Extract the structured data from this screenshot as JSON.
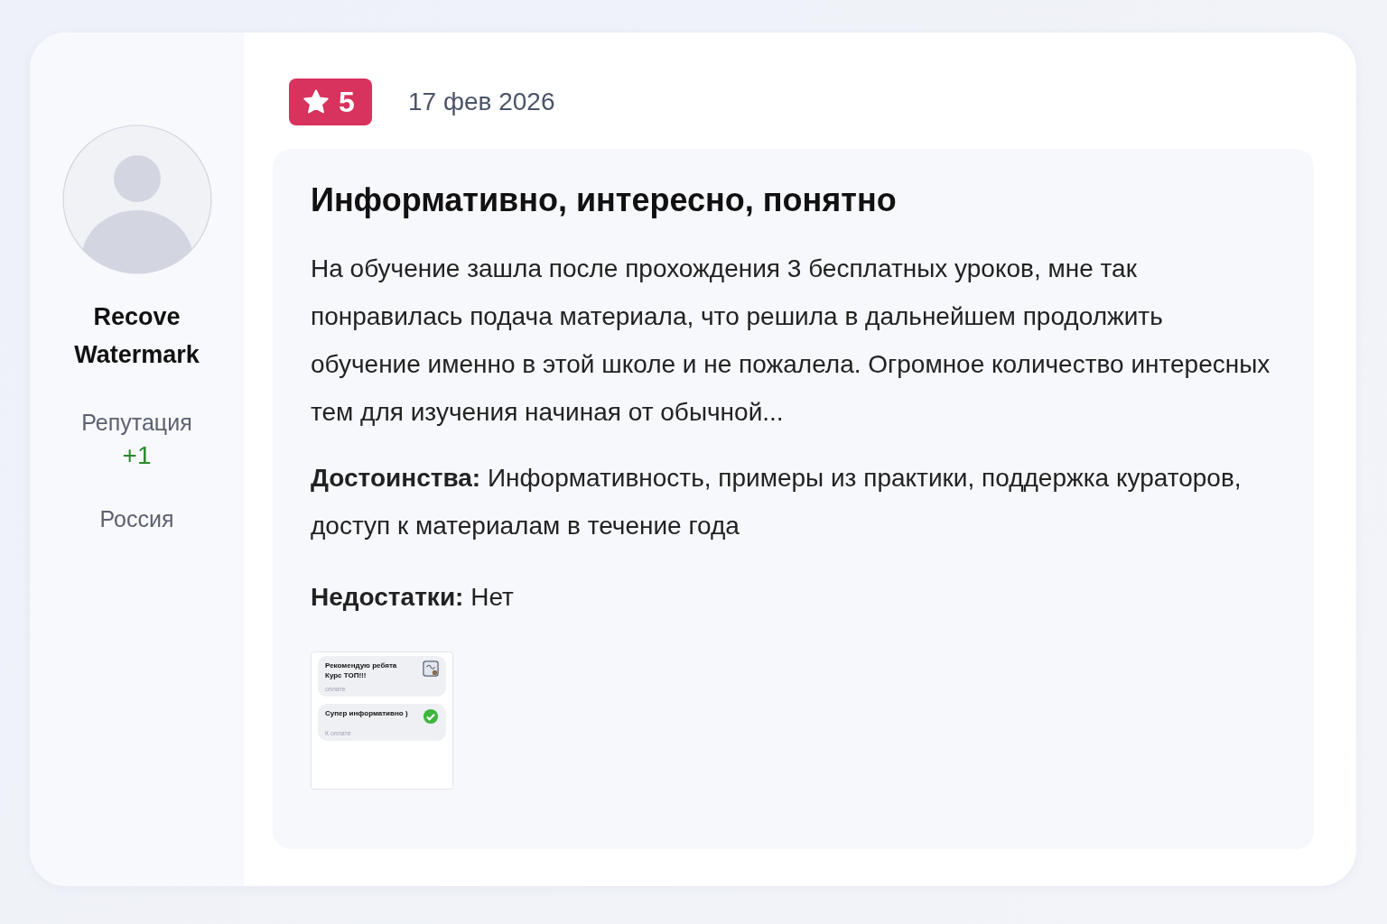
{
  "rating": {
    "value": "5"
  },
  "date": "17 фев 2026",
  "author": {
    "name": "Recove Watermark",
    "reputation_label": "Репутация",
    "reputation": "+1",
    "location": "Россия"
  },
  "review": {
    "title": "Информативно, интересно, понятно",
    "text": "На обучение зашла после прохождения 3 бесплатных уроков, мне так понравилась подача материала, что решила в дальнейшем продолжить обучение именно в этой школе и не пожалела. Огромное количество интересных тем для изучения начиная от обычной...",
    "pros": "**Достоинства:** Информативность, примеры из практики, поддержка кураторов, доступ к материалам в течение года",
    "cons": "**Недостатки:** Нет",
    "attachment": {
      "messages": [
        {
          "kind": "pending",
          "lines": [
            "Рекомендую ребята",
            "Курс ТОП!!!"
          ],
          "note": "оплате"
        },
        {
          "kind": "done",
          "lines": [
            "Супер информативно )"
          ],
          "note": "К  оплате"
        }
      ]
    }
  }
}
